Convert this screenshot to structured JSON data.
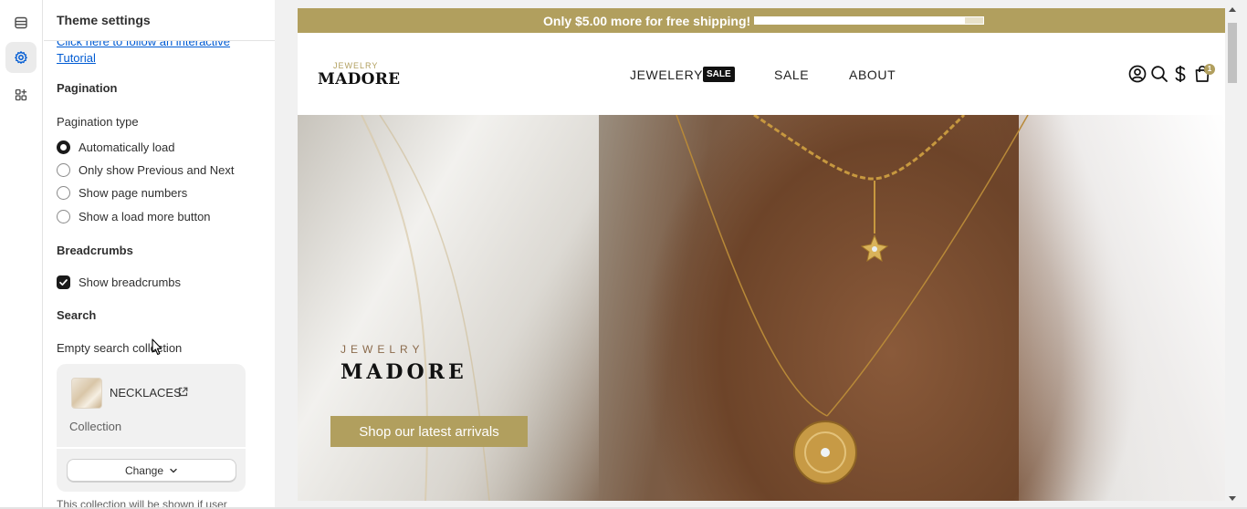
{
  "rail": {
    "items": [
      {
        "icon": "sections-icon"
      },
      {
        "icon": "gear-icon",
        "active": true
      },
      {
        "icon": "apps-icon"
      }
    ]
  },
  "panel": {
    "title": "Theme settings",
    "tutorial_link": "Click here to follow an interactive Tutorial",
    "pagination": {
      "heading": "Pagination",
      "type_label": "Pagination type",
      "options": [
        {
          "label": "Automatically load",
          "checked": true
        },
        {
          "label": "Only show Previous and Next",
          "checked": false
        },
        {
          "label": "Show page numbers",
          "checked": false
        },
        {
          "label": "Show a load more button",
          "checked": false
        }
      ]
    },
    "breadcrumbs": {
      "heading": "Breadcrumbs",
      "show_label": "Show breadcrumbs",
      "checked": true
    },
    "search": {
      "heading": "Search",
      "empty_label": "Empty search collection",
      "collection_name": "NECKLACES",
      "collection_type": "Collection",
      "change_label": "Change",
      "help_text": "This collection will be shown if user"
    }
  },
  "preview": {
    "announcement": "Only $5.00 more for free shipping!",
    "shipping_progress": 0.92,
    "logo_small": "JEWELRY",
    "logo_big": "MADORE",
    "nav": [
      {
        "label": "JEWELERY",
        "badge": "SALE"
      },
      {
        "label": "SALE"
      },
      {
        "label": "ABOUT"
      }
    ],
    "header_icons": [
      "account-icon",
      "search-icon",
      "currency-icon",
      "cart-icon"
    ],
    "cart_count": "1",
    "hero": {
      "kicker": "JEWELRY",
      "title": "MADORE",
      "button": "Shop our latest arrivals"
    }
  },
  "colors": {
    "accent": "#b19f5e",
    "link": "#005bd3",
    "dark": "#1a1a1a"
  }
}
